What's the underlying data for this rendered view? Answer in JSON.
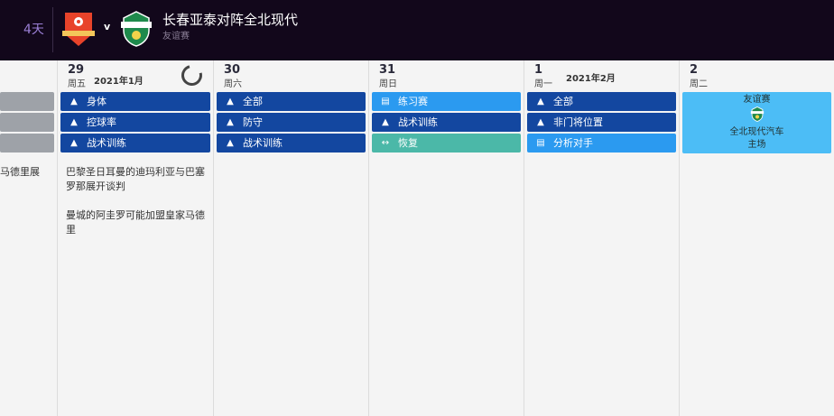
{
  "header": {
    "days_left": "4天",
    "vs": "v",
    "match_title": "长春亚泰对阵全北现代",
    "match_type": "友谊赛"
  },
  "left_column": {
    "news": "马德里展"
  },
  "columns": [
    {
      "day": "29",
      "weekday": "周五",
      "month": "2021年1月",
      "items": [
        {
          "icon": "cone-icon",
          "label": "身体",
          "color": "#1347a0"
        },
        {
          "icon": "cone-icon",
          "label": "控球率",
          "color": "#1347a0"
        },
        {
          "icon": "cone-icon",
          "label": "战术训练",
          "color": "#1347a0"
        }
      ],
      "news": [
        "巴黎圣日耳曼的迪玛利亚与巴塞罗那展开谈判",
        "曼城的阿圭罗可能加盟皇家马德里"
      ]
    },
    {
      "day": "30",
      "weekday": "周六",
      "items": [
        {
          "icon": "cone-icon",
          "label": "全部"
        },
        {
          "icon": "cone-icon",
          "label": "防守"
        },
        {
          "icon": "cone-icon",
          "label": "战术训练"
        }
      ]
    },
    {
      "day": "31",
      "weekday": "周日",
      "items": [
        {
          "icon": "document-icon",
          "label": "练习赛"
        },
        {
          "icon": "cone-icon",
          "label": "战术训练"
        },
        {
          "icon": "recovery-icon",
          "label": "恢复"
        }
      ]
    },
    {
      "day": "1",
      "weekday": "周一",
      "month": "2021年2月",
      "items": [
        {
          "icon": "cone-icon",
          "label": "全部"
        },
        {
          "icon": "cone-icon",
          "label": "非门将位置"
        },
        {
          "icon": "document-icon",
          "label": "分析对手"
        }
      ]
    },
    {
      "day": "2",
      "weekday": "周二",
      "match": {
        "type": "友谊赛",
        "opponent": "全北现代汽车",
        "venue": "主场"
      }
    }
  ]
}
